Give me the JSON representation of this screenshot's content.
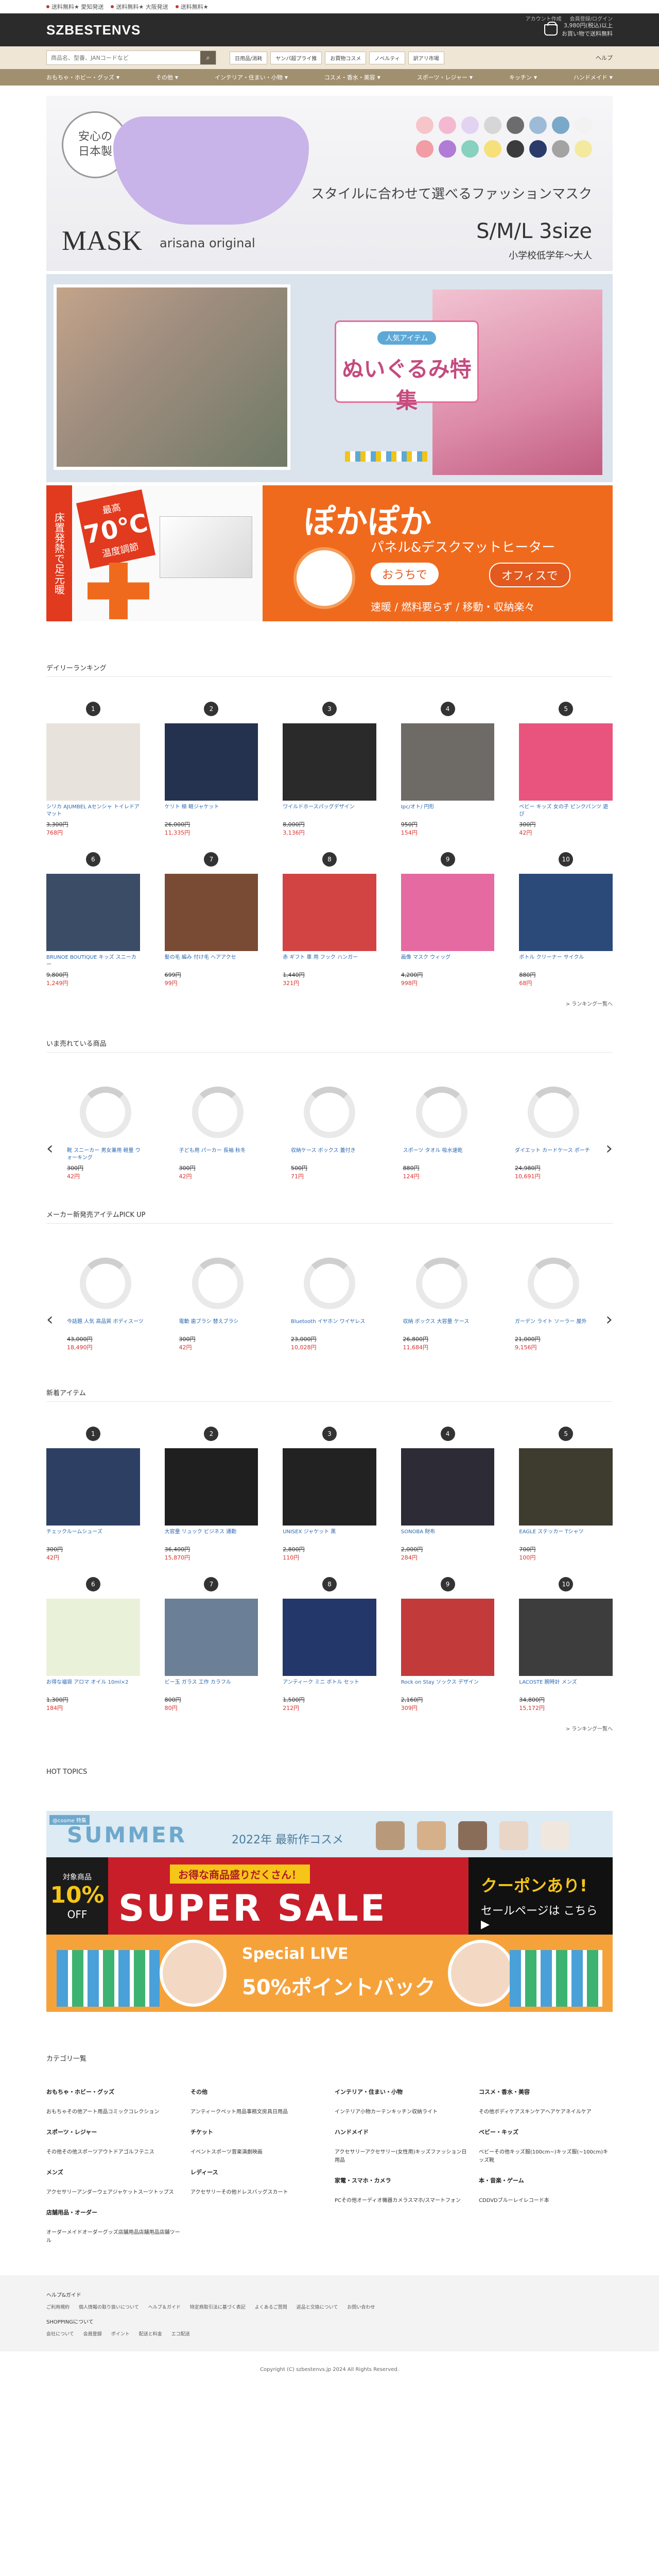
{
  "topstrip": [
    "送料無料★ 愛知発送",
    "送料無料★ 大阪発送",
    "送料無料★"
  ],
  "header": {
    "logo": "SZBESTENVS",
    "links": [
      "アカウント作成",
      "会員登録/ログイン"
    ],
    "cart_lines": [
      "3,980円(税込)以上",
      "お買い物で送料無料"
    ],
    "help": "ヘルプ"
  },
  "search": {
    "placeholder": "商品名、型番、JANコードなど",
    "tags": [
      "日用品/消耗",
      "ヤンパ超プライ推",
      "お買物コスメ",
      "ノベルティ",
      "訳アリ市場"
    ]
  },
  "nav": [
    "おもちゃ・ホビー・グッズ",
    "その他",
    "インテリア・住まい・小物",
    "コスメ・香水・美容",
    "スポーツ・レジャー",
    "キッチン",
    "ハンドメイド"
  ],
  "banner1": {
    "badge": [
      "安心の",
      "日本製"
    ],
    "tagline": "スタイルに合わせて選べるファッションマスク",
    "word": "MASK",
    "brand": "arisana original",
    "sizes": "S/M/L 3size",
    "sub": "小学校低学年〜大人",
    "swatches": [
      "#f7c5c9",
      "#f4b9d1",
      "#e3d3f2",
      "#d6d6d6",
      "#6c6c6c",
      "#9dbbd6",
      "#7aa8c9",
      "#f2f2f2",
      "#f29ca6",
      "#b07cd6",
      "#88d0c0",
      "#f5e07a",
      "#3b3b3b",
      "#2a3b6b",
      "#a3a3a3",
      "#f3eaa0"
    ]
  },
  "banner2": {
    "pill": "人気アイテム",
    "title": "ぬいぐるみ特集"
  },
  "banner3": {
    "vbar": "床置発熱で足元暖",
    "badge_top": "最高",
    "badge_num": "70℃",
    "badge_bottom": "温度調節",
    "title": "ぽかぽか",
    "sub": "パネル&デスクマットヒーター",
    "pill1": "おうちで",
    "pill2": "オフィスで",
    "footline": "速暖 / 燃料要らず / 移動・収納楽々"
  },
  "daily": {
    "title": "デイリーランキング",
    "more": "> ランキング一覧へ",
    "items": [
      {
        "rank": "1",
        "name": "シリカ AJUMBEL Aセンシャ トイレドアマット",
        "old": "3,300円",
        "new": "768円",
        "color": "#e8e2dc"
      },
      {
        "rank": "2",
        "name": "ケリト 極 軽ジャケット",
        "old": "26,000円",
        "new": "11,335円",
        "color": "#24324f"
      },
      {
        "rank": "3",
        "name": "ワイルドホースパッグデザイン",
        "old": "8,000円",
        "new": "3,136円",
        "color": "#2a2a2a"
      },
      {
        "rank": "4",
        "name": "Ipc/オト/ 円形",
        "old": "950円",
        "new": "154円",
        "color": "#6e6a66"
      },
      {
        "rank": "5",
        "name": "ベビー キッズ 女の子 ピンクパンツ 遊び",
        "old": "300円",
        "new": "42円",
        "color": "#e8547d"
      },
      {
        "rank": "6",
        "name": "BRUNOE BOUTIQUE キッズ スニーカー",
        "old": "9,800円",
        "new": "1,249円",
        "color": "#3b4c66"
      },
      {
        "rank": "7",
        "name": "髪の毛 編み 付け毛 ヘアアクセ",
        "old": "699円",
        "new": "99円",
        "color": "#7a4b34"
      },
      {
        "rank": "8",
        "name": "赤 ギフト 車 用 フック ハンガー",
        "old": "1,440円",
        "new": "321円",
        "color": "#d24343"
      },
      {
        "rank": "9",
        "name": "画像 マスク ウィッグ",
        "old": "4,200円",
        "new": "998円",
        "color": "#e56aa1"
      },
      {
        "rank": "10",
        "name": "ボトル クリーナー サイクル",
        "old": "880円",
        "new": "68円",
        "color": "#2b4a7a"
      }
    ]
  },
  "popular": {
    "title": "いま売れている商品",
    "items": [
      {
        "name": "靴 スニーカー 男女兼用 軽量 ウォーキング",
        "old": "300円",
        "new": "42円"
      },
      {
        "name": "子ども用 パーカー 長袖 秋冬",
        "old": "300円",
        "new": "42円"
      },
      {
        "name": "収納ケース ボックス 蓋付き",
        "old": "500円",
        "new": "71円"
      },
      {
        "name": "スポーツ タオル 吸水速乾",
        "old": "880円",
        "new": "124円"
      },
      {
        "name": "ダイエット カードケース ポーチ",
        "old": "24,980円",
        "new": "10,691円"
      }
    ]
  },
  "maker": {
    "title": "メーカー新発売アイテムPICK UP",
    "items": [
      {
        "name": "今話題 人気 高品質 ボディスーツ",
        "old": "43,000円",
        "new": "18,490円"
      },
      {
        "name": "電動 歯ブラシ 替えブラシ",
        "old": "300円",
        "new": "42円"
      },
      {
        "name": "Bluetooth イヤホン ワイヤレス",
        "old": "23,000円",
        "new": "10,028円"
      },
      {
        "name": "収納 ボックス 大容量 ケース",
        "old": "26,800円",
        "new": "11,684円"
      },
      {
        "name": "ガーデン ライト ソーラー 屋外",
        "old": "21,000円",
        "new": "9,156円"
      }
    ]
  },
  "newitems": {
    "title": "新着アイテム",
    "more": "> ランキング一覧へ",
    "items": [
      {
        "rank": "1",
        "name": "チェックルームシューズ",
        "old": "300円",
        "new": "42円",
        "color": "#2e3f64"
      },
      {
        "rank": "2",
        "name": "大容量 リュック ビジネス 通勤",
        "old": "36,400円",
        "new": "15,870円",
        "color": "#1f1f1f"
      },
      {
        "rank": "3",
        "name": "UNISEX ジャケット 黒",
        "old": "2,800円",
        "new": "110円",
        "color": "#222222"
      },
      {
        "rank": "4",
        "name": "SONOBA 財布",
        "old": "2,000円",
        "new": "284円",
        "color": "#2d2b36"
      },
      {
        "rank": "5",
        "name": "EAGLE ステッカー Tシャツ",
        "old": "700円",
        "new": "100円",
        "color": "#3e3b2f"
      },
      {
        "rank": "6",
        "name": "お得な福袋 アロマ オイル 10ml×2",
        "old": "1,300円",
        "new": "184円",
        "color": "#e9f2d8"
      },
      {
        "rank": "7",
        "name": "ビー玉 ガラス 工作 カラフル",
        "old": "800円",
        "new": "80円",
        "color": "#6b7f96"
      },
      {
        "rank": "8",
        "name": "アンティーク ミニ ボトル セット",
        "old": "1,500円",
        "new": "212円",
        "color": "#23376a"
      },
      {
        "rank": "9",
        "name": "Rock on Stay ソックス デザイン",
        "old": "2,160円",
        "new": "309円",
        "color": "#c33a3a"
      },
      {
        "rank": "10",
        "name": "LACOSTE 腕時計 メンズ",
        "old": "34,800円",
        "new": "15,172円",
        "color": "#3d3d3d"
      }
    ]
  },
  "hot": {
    "title": "HOT TOPICS",
    "h1": {
      "tag": "@cosme 特集",
      "word": "SUMMER",
      "year": "2022年 最新作コスメ"
    },
    "h2": {
      "left_top": "対象商品",
      "left_num": "10%",
      "left_bottom": "OFF",
      "ribbon": "お得な商品盛りだくさん！",
      "sale": "SUPER SALE",
      "right1": "クーポンあり!",
      "right2": "セールページは こちら ▶"
    },
    "h3": {
      "live": "Special LIVE",
      "pct": "50%ポイントバック"
    }
  },
  "categories": {
    "title": "カテゴリ一覧",
    "cols": [
      {
        "head": "おもちゃ・ホビー・グッズ",
        "items": [
          "おもちゃ",
          "その他",
          "アート用品",
          "コミック",
          "コレクション"
        ],
        "sub": [
          {
            "head": "スポーツ・レジャー",
            "items": [
              "その他",
              "その他スポーツ",
              "アウトドア",
              "ゴルフ",
              "テニス"
            ]
          },
          {
            "head": "メンズ",
            "items": [
              "アクセサリー",
              "アンダーウェア",
              "ジャケット",
              "スーツ",
              "トップス"
            ]
          },
          {
            "head": "店舗用品・オーダー",
            "items": [
              "オーダーメイド",
              "オーダーグッズ",
              "店舗用品",
              "店舗用品",
              "店舗ツール"
            ]
          }
        ]
      },
      {
        "head": "その他",
        "items": [
          "アンティーク",
          "ペット用品",
          "事務",
          "文房具",
          "日用品"
        ],
        "sub": [
          {
            "head": "チケット",
            "items": [
              "イベント",
              "スポーツ",
              "音楽",
              "演劇",
              "映画"
            ]
          },
          {
            "head": "レディース",
            "items": [
              "アクセサリー",
              "その他",
              "ドレス",
              "バッグ",
              "スカート"
            ]
          }
        ]
      },
      {
        "head": "インテリア・住まい・小物",
        "items": [
          "インテリア小物",
          "カーテン",
          "キッチン",
          "収納",
          "ライト"
        ],
        "sub": [
          {
            "head": "ハンドメイド",
            "items": [
              "アクセサリー",
              "アクセサリー(女性用)",
              "キッズ",
              "ファッション",
              "日用品"
            ]
          },
          {
            "head": "家電・スマホ・カメラ",
            "items": [
              "PC",
              "その他",
              "オーディオ機器",
              "カメラ",
              "スマホ/スマートフォン"
            ]
          }
        ]
      },
      {
        "head": "コスメ・香水・美容",
        "items": [
          "その他",
          "ボディケア",
          "スキンケア",
          "ヘアケア",
          "ネイルケア"
        ],
        "sub": [
          {
            "head": "ベビー・キッズ",
            "items": [
              "ベビー",
              "その他",
              "キッズ服(100cm~)",
              "キッズ服(~100cm)",
              "キッズ靴"
            ]
          },
          {
            "head": "本・音楽・ゲーム",
            "items": [
              "CD",
              "DVD",
              "ブルーレイ",
              "レコード",
              "本"
            ]
          }
        ]
      }
    ]
  },
  "footer": {
    "guide_title": "ヘルプ&ガイド",
    "guide_links": [
      "ご利用規約",
      "個人情報の取り扱いについて",
      "ヘルプ＆ガイド",
      "特定商取引法に基づく表記",
      "よくあるご質問",
      "返品と交換について",
      "お問い合わせ"
    ],
    "shop_title": "SHOPPINGについて",
    "shop_links": [
      "会社について",
      "会員登録",
      "ポイント",
      "配送と料金",
      "エコ配送"
    ],
    "copyright": "Copyright (C) szbestenvs.jp 2024 All Rights Reserved."
  }
}
